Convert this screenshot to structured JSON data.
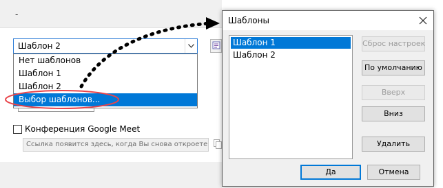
{
  "background": {
    "dash": "-",
    "template_combo": {
      "value": "Шаблон 2"
    },
    "dropdown_options": [
      {
        "label": "Нет шаблонов",
        "selected": false
      },
      {
        "label": "Шаблон 1",
        "selected": false
      },
      {
        "label": "Шаблон 2",
        "selected": false
      },
      {
        "label": "Выбор шаблонов...",
        "selected": true
      }
    ],
    "google_meet": {
      "label": "Конференция Google Meet",
      "checked": false
    },
    "link_placeholder": "Ссылка появится здесь, когда Вы снова откроете"
  },
  "dialog": {
    "title": "Шаблоны",
    "list_items": [
      {
        "label": "Шаблон 1",
        "selected": true
      },
      {
        "label": "Шаблон 2",
        "selected": false
      }
    ],
    "buttons": {
      "reset": "Сброс настроек",
      "default": "По умолчанию",
      "up": "Вверх",
      "down": "Вниз",
      "delete": "Удалить",
      "ok": "Да",
      "cancel": "Отмена"
    }
  },
  "colors": {
    "selection": "#0078d7",
    "highlight_ellipse": "#e8444a",
    "arrow": "#000000"
  }
}
